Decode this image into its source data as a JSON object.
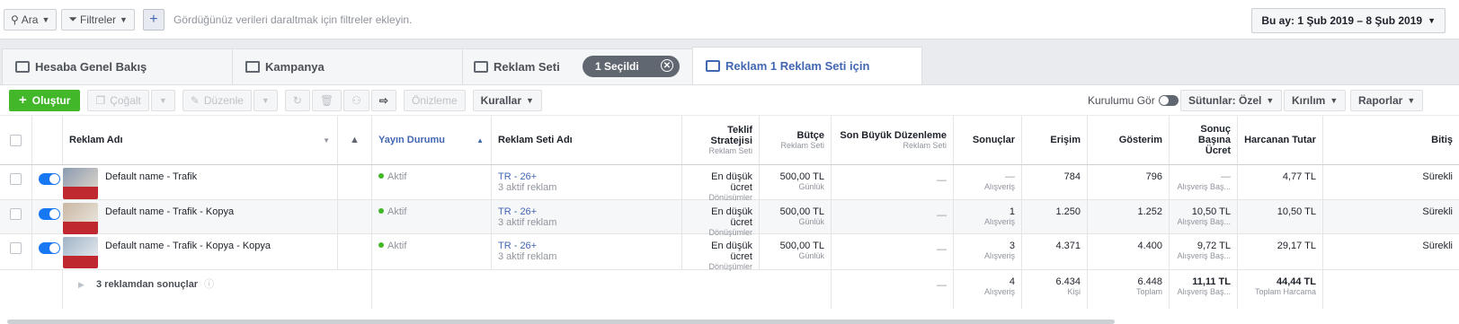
{
  "filterbar": {
    "search_label": "Ara",
    "filters_label": "Filtreler",
    "hint": "Gördüğünüz verileri daraltmak için filtreler ekleyin.",
    "date_range": "Bu ay: 1 Şub 2019 – 8 Şub 2019"
  },
  "tabs": {
    "account": "Hesaba Genel Bakış",
    "campaign": "Kampanya",
    "adset": "Reklam Seti",
    "selected_pill": "1 Seçildi",
    "ads": "Reklam 1 Reklam Seti için"
  },
  "toolbar": {
    "create": "Oluştur",
    "duplicate": "Çoğalt",
    "edit": "Düzenle",
    "preview": "Önizleme",
    "rules": "Kurallar",
    "view_setup": "Kurulumu Gör",
    "columns": "Sütunlar: Özel",
    "breakdown": "Kırılım",
    "reports": "Raporlar"
  },
  "columns": {
    "ad_name": "Reklam Adı",
    "delivery": "Yayın Durumu",
    "adset_name": "Reklam Seti Adı",
    "bid_strategy": "Teklif Stratejisi",
    "bid_strategy_sub": "Reklam Seti",
    "budget": "Bütçe",
    "budget_sub": "Reklam Seti",
    "last_edit": "Son Büyük Düzenleme",
    "last_edit_sub": "Reklam Seti",
    "results": "Sonuçlar",
    "reach": "Erişim",
    "impressions": "Gösterim",
    "cost_per_result_1": "Sonuç",
    "cost_per_result_2": "Başına Ücret",
    "spent": "Harcanan Tutar",
    "ends": "Bitiş"
  },
  "rows": [
    {
      "name": "Default name - Trafik",
      "delivery": "Aktif",
      "adset": "TR - 26+",
      "adset_sub": "3 aktif reklam",
      "bid": "En düşük ücret",
      "bid_sub": "Dönüşümler",
      "budget": "500,00 TL",
      "budget_sub": "Günlük",
      "last_edit": "—",
      "results": "—",
      "results_sub": "Alışveriş",
      "reach": "784",
      "impressions": "796",
      "cpr": "—",
      "cpr_sub": "Alışveriş Baş...",
      "spent": "4,77 TL",
      "ends": "Sürekli"
    },
    {
      "name": "Default name - Trafik - Kopya",
      "delivery": "Aktif",
      "adset": "TR - 26+",
      "adset_sub": "3 aktif reklam",
      "bid": "En düşük ücret",
      "bid_sub": "Dönüşümler",
      "budget": "500,00 TL",
      "budget_sub": "Günlük",
      "last_edit": "—",
      "results": "1",
      "results_sub": "Alışveriş",
      "reach": "1.250",
      "impressions": "1.252",
      "cpr": "10,50 TL",
      "cpr_sub": "Alışveriş Baş...",
      "spent": "10,50 TL",
      "ends": "Sürekli"
    },
    {
      "name": "Default name - Trafik - Kopya - Kopya",
      "delivery": "Aktif",
      "adset": "TR - 26+",
      "adset_sub": "3 aktif reklam",
      "bid": "En düşük ücret",
      "bid_sub": "Dönüşümler",
      "budget": "500,00 TL",
      "budget_sub": "Günlük",
      "last_edit": "—",
      "results": "3",
      "results_sub": "Alışveriş",
      "reach": "4.371",
      "impressions": "4.400",
      "cpr": "9,72 TL",
      "cpr_sub": "Alışveriş Baş...",
      "spent": "29,17 TL",
      "ends": "Sürekli"
    }
  ],
  "summary": {
    "label": "3 reklamdan sonuçlar",
    "last_edit": "—",
    "results": "4",
    "results_sub": "Alışveriş",
    "reach": "6.434",
    "reach_sub": "Kişi",
    "impressions": "6.448",
    "impressions_sub": "Toplam",
    "cpr": "11,11 TL",
    "cpr_sub": "Alışveriş Baş...",
    "spent": "44,44 TL",
    "spent_sub": "Toplam Harcama"
  }
}
